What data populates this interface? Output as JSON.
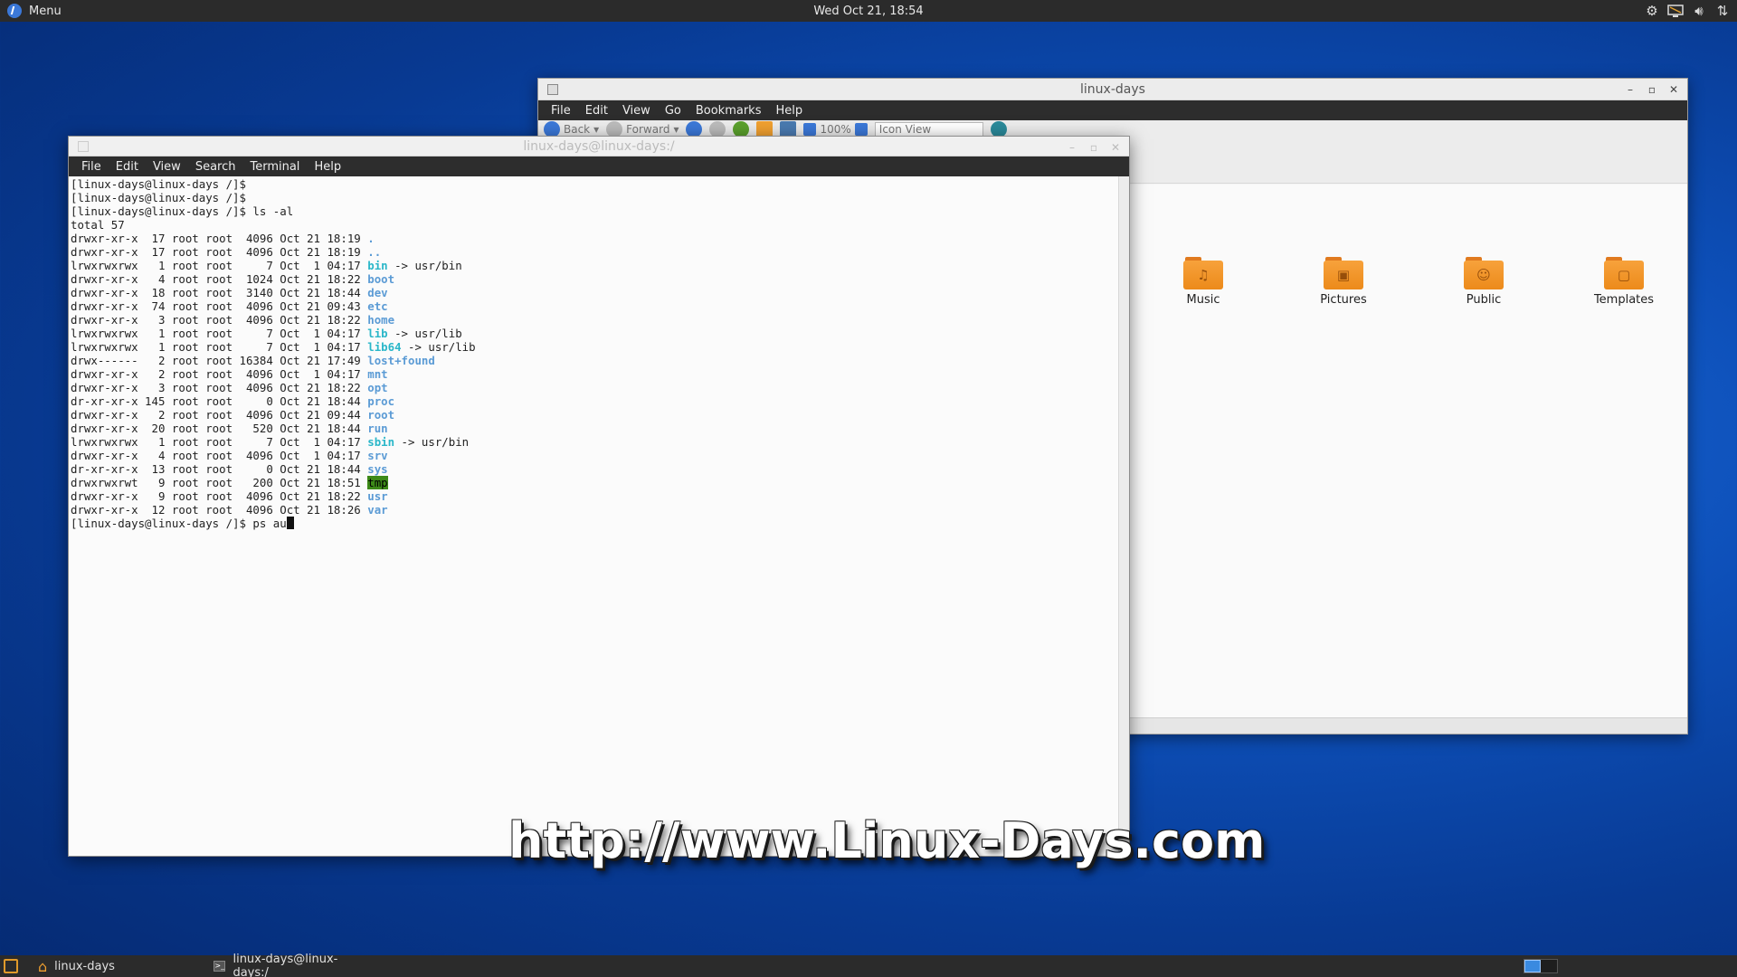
{
  "top_panel": {
    "menu_label": "Menu",
    "clock": "Wed Oct 21, 18:54",
    "tray_icons": [
      "settings-icon",
      "display-icon",
      "volume-icon",
      "network-icon"
    ]
  },
  "file_manager": {
    "title": "linux-days",
    "menu": [
      "File",
      "Edit",
      "View",
      "Go",
      "Bookmarks",
      "Help"
    ],
    "toolbar": {
      "back": "Back",
      "forward": "Forward",
      "zoom": "100%",
      "view_mode": "Icon View"
    },
    "folders": [
      {
        "label": "Music",
        "icon": "music-icon",
        "glyph": "♫"
      },
      {
        "label": "Pictures",
        "icon": "picture-icon",
        "glyph": "▣"
      },
      {
        "label": "Public",
        "icon": "people-icon",
        "glyph": "☺"
      },
      {
        "label": "Templates",
        "icon": "template-icon",
        "glyph": "▢"
      }
    ]
  },
  "terminal": {
    "title": "linux-days@linux-days:/",
    "menu": [
      "File",
      "Edit",
      "View",
      "Search",
      "Terminal",
      "Help"
    ],
    "prompt": "[linux-days@linux-days /]$",
    "lines": [
      {
        "text": "[linux-days@linux-days /]$",
        "name": "",
        "kind": "plain",
        "suffix": ""
      },
      {
        "text": "[linux-days@linux-days /]$",
        "name": "",
        "kind": "plain",
        "suffix": ""
      },
      {
        "text": "[linux-days@linux-days /]$ ls -al",
        "name": "",
        "kind": "plain",
        "suffix": ""
      },
      {
        "text": "total 57",
        "name": "",
        "kind": "plain",
        "suffix": ""
      },
      {
        "text": "drwxr-xr-x  17 root root  4096 Oct 21 18:19 ",
        "name": ".",
        "kind": "dir",
        "suffix": ""
      },
      {
        "text": "drwxr-xr-x  17 root root  4096 Oct 21 18:19 ",
        "name": "..",
        "kind": "dir",
        "suffix": ""
      },
      {
        "text": "lrwxrwxrwx   1 root root     7 Oct  1 04:17 ",
        "name": "bin",
        "kind": "link",
        "suffix": " -> usr/bin"
      },
      {
        "text": "drwxr-xr-x   4 root root  1024 Oct 21 18:22 ",
        "name": "boot",
        "kind": "dir",
        "suffix": ""
      },
      {
        "text": "drwxr-xr-x  18 root root  3140 Oct 21 18:44 ",
        "name": "dev",
        "kind": "dir",
        "suffix": ""
      },
      {
        "text": "drwxr-xr-x  74 root root  4096 Oct 21 09:43 ",
        "name": "etc",
        "kind": "dir",
        "suffix": ""
      },
      {
        "text": "drwxr-xr-x   3 root root  4096 Oct 21 18:22 ",
        "name": "home",
        "kind": "dir",
        "suffix": ""
      },
      {
        "text": "lrwxrwxrwx   1 root root     7 Oct  1 04:17 ",
        "name": "lib",
        "kind": "link",
        "suffix": " -> usr/lib"
      },
      {
        "text": "lrwxrwxrwx   1 root root     7 Oct  1 04:17 ",
        "name": "lib64",
        "kind": "link",
        "suffix": " -> usr/lib"
      },
      {
        "text": "drwx------   2 root root 16384 Oct 21 17:49 ",
        "name": "lost+found",
        "kind": "dir",
        "suffix": ""
      },
      {
        "text": "drwxr-xr-x   2 root root  4096 Oct  1 04:17 ",
        "name": "mnt",
        "kind": "dir",
        "suffix": ""
      },
      {
        "text": "drwxr-xr-x   3 root root  4096 Oct 21 18:22 ",
        "name": "opt",
        "kind": "dir",
        "suffix": ""
      },
      {
        "text": "dr-xr-xr-x 145 root root     0 Oct 21 18:44 ",
        "name": "proc",
        "kind": "dir",
        "suffix": ""
      },
      {
        "text": "drwxr-xr-x   2 root root  4096 Oct 21 09:44 ",
        "name": "root",
        "kind": "dir",
        "suffix": ""
      },
      {
        "text": "drwxr-xr-x  20 root root   520 Oct 21 18:44 ",
        "name": "run",
        "kind": "dir",
        "suffix": ""
      },
      {
        "text": "lrwxrwxrwx   1 root root     7 Oct  1 04:17 ",
        "name": "sbin",
        "kind": "link",
        "suffix": " -> usr/bin"
      },
      {
        "text": "drwxr-xr-x   4 root root  4096 Oct  1 04:17 ",
        "name": "srv",
        "kind": "dir",
        "suffix": ""
      },
      {
        "text": "dr-xr-xr-x  13 root root     0 Oct 21 18:44 ",
        "name": "sys",
        "kind": "dir",
        "suffix": ""
      },
      {
        "text": "drwxrwxrwt   9 root root   200 Oct 21 18:51 ",
        "name": "tmp",
        "kind": "sticky",
        "suffix": ""
      },
      {
        "text": "drwxr-xr-x   9 root root  4096 Oct 21 18:22 ",
        "name": "usr",
        "kind": "dir",
        "suffix": ""
      },
      {
        "text": "drwxr-xr-x  12 root root  4096 Oct 21 18:26 ",
        "name": "var",
        "kind": "dir",
        "suffix": ""
      }
    ],
    "current_input": "[linux-days@linux-days /]$ ps au"
  },
  "watermark": "http://www.Linux-Days.com",
  "taskbar": {
    "tasks": [
      {
        "label": "linux-days",
        "icon": "home-folder-icon"
      },
      {
        "label": "linux-days@linux-days:/",
        "icon": "terminal-icon"
      }
    ]
  },
  "colors": {
    "dir": "#5b9bd5",
    "link": "#2ab7c9",
    "sticky_bg": "#3d8a18",
    "folder": "#f7a23c",
    "panel": "#2b2b2b",
    "desktop": "#0d4fb8"
  }
}
